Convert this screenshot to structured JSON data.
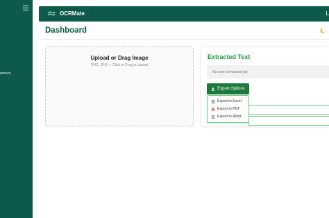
{
  "sidebar": {
    "side_label": "ement"
  },
  "topbar": {
    "brand": "OCRMate",
    "edge_text": "L"
  },
  "page": {
    "title": "Dashboard"
  },
  "upload": {
    "title": "Upload or Drag Image",
    "subtitle": "PNG, JPG — Click or Drag to upload"
  },
  "result": {
    "title": "Extracted Text",
    "placeholder": "No text extracted yet.",
    "export_label": "Export Options",
    "menu": [
      {
        "label": "Export to Excel",
        "icon": "excel-icon",
        "color": "#1d7a3d"
      },
      {
        "label": "Export to PDF",
        "icon": "pdf-icon",
        "color": "#d33a3a"
      },
      {
        "label": "Export to Word",
        "icon": "word-icon",
        "color": "#6a7a8c"
      }
    ]
  },
  "colors": {
    "brand": "#0e5a4a",
    "accent": "#1e9a3c",
    "button": "#1d7a3d"
  }
}
